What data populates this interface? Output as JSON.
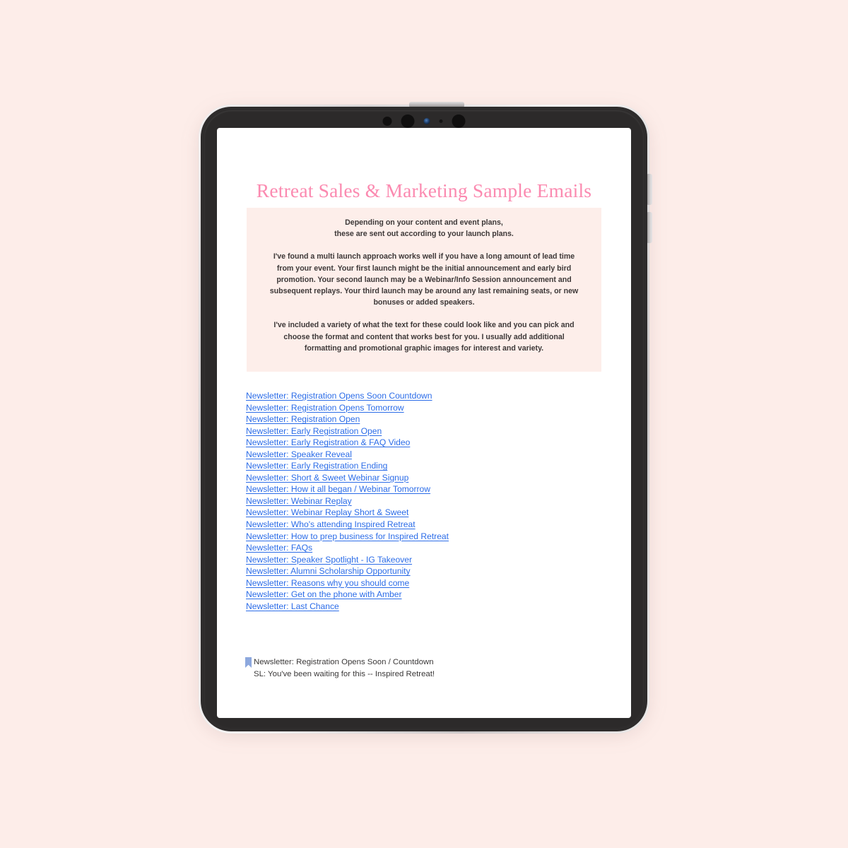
{
  "device": {
    "type": "tablet",
    "power_button": "power-button",
    "volume_up_button": "volume-up-button",
    "volume_down_button": "volume-down-button",
    "camera": "front-camera"
  },
  "document": {
    "title": "Retreat Sales & Marketing Sample Emails",
    "title_color": "#fb8ab0",
    "intro_box_color": "#fdeeea",
    "link_color": "#2b6ce8",
    "intro_paragraphs": [
      "Depending on your content and event plans,\nthese are sent out according to your launch plans.",
      "I've found a multi launch approach works well if you have a long amount of lead time from your event. Your first launch might be the initial announcement and early bird promotion. Your second launch may be a Webinar/Info Session announcement and subsequent replays. Your third launch may be around any last remaining seats, or new bonuses or added speakers.",
      "I've included a variety of what the text for these could look like and you can pick and choose the format and content that works best for you. I usually add additional formatting and promotional graphic images for interest and variety."
    ],
    "links": [
      "Newsletter: Registration Opens Soon Countdown",
      "Newsletter: Registration Opens Tomorrow",
      "Newsletter: Registration Open",
      "Newsletter: Early Registration Open",
      "Newsletter: Early Registration & FAQ Video",
      "Newsletter: Speaker Reveal",
      "Newsletter: Early Registration Ending",
      "Newsletter: Short & Sweet Webinar Signup",
      "Newsletter: How it all began / Webinar Tomorrow",
      "Newsletter: Webinar Replay",
      "Newsletter: Webinar Replay Short & Sweet",
      "Newsletter: Who's attending Inspired Retreat",
      "Newsletter: How to prep business for Inspired Retreat",
      "Newsletter: FAQs",
      "Newsletter: Speaker Spotlight - IG Takeover",
      "Newsletter: Alumni Scholarship Opportunity",
      "Newsletter: Reasons why you should come",
      "Newsletter: Get on the phone with Amber",
      "Newsletter: Last Chance"
    ],
    "bookmark_section": {
      "icon": "bookmark-icon",
      "icon_color": "#8da8de",
      "heading": "Newsletter: Registration Opens Soon / Countdown",
      "subject_line": "SL: You've been waiting for this -- Inspired Retreat!"
    }
  }
}
